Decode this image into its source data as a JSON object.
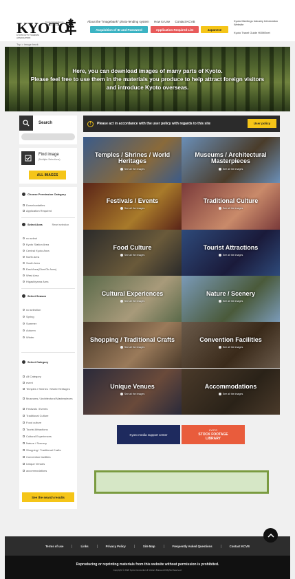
{
  "header": {
    "logo": "KYOTO",
    "logo_subtitle": "KYOTO CITY TOURISM ASSOCIATION",
    "logo_caption": "Kyoto Convention & Visitors Bureau",
    "nav_links": [
      "About the \"imagebank\" photo-lending system",
      "How to Use",
      "Contact KCVB"
    ],
    "right_links": [
      "Kyoto Meetings Industry Information Website",
      "Kyoto Travel Guide HOMEnet"
    ],
    "buttons": {
      "acquisition": "Acquisition of ID and Password",
      "application": "Application Required List",
      "language": "Japanese"
    }
  },
  "breadcrumb": "Top > image bank",
  "hero": {
    "line1": "Here, you can download images of many parts of Kyoto.",
    "line2": "Please feel free to use them in the materials you produce to help attract foreign visitors",
    "line3": "and introduce Kyoto overseas."
  },
  "search": {
    "label": "Search",
    "placeholder": ""
  },
  "find": {
    "label": "Find image",
    "sub": "(Multiple Selections)",
    "all_images": "ALL IMAGES"
  },
  "filters": {
    "permission": {
      "title": "Choose Permission Category",
      "items": [
        "Downloadables",
        "Application Required"
      ]
    },
    "area": {
      "title": "Select Area",
      "reset": "Reset selection",
      "items": [
        "no select",
        "Kyoto Station Area",
        "Central Kyoto Area",
        "North Area",
        "South Area",
        "East Area(Gion/Ok Area)",
        "West Area",
        "Higashiyama Area"
      ]
    },
    "season": {
      "title": "Select Season",
      "items": [
        "no selection",
        "Spring",
        "Summer",
        "Autumn",
        "Winter"
      ]
    },
    "category": {
      "title": "Select Category",
      "items": [
        "All Category",
        "event",
        "Temples / Shrines / World Heritages",
        "Museums / Architectural Masterpieces",
        "Festivals / Events",
        "Traditional Culture",
        "Food culture",
        "Tourist Attractions",
        "Cultural Experiences",
        "Nature / Scenery",
        "Shopping / Traditional Crafts",
        "Convention facilities",
        "Unique Venues",
        "accommodations"
      ]
    },
    "see_results": "See the search results"
  },
  "notice": {
    "text": "Please act in accordance with the user policy with regards to this site",
    "button": "User policy"
  },
  "tiles": [
    {
      "title": "Temples / Shrines / World Heritages",
      "see": "See all the images",
      "bg1": "#3a5b8a",
      "bg2": "#8a6a3a"
    },
    {
      "title": "Museums / Architectural Masterpieces",
      "see": "See all the images",
      "bg1": "#6a8fb8",
      "bg2": "#4a3c2a"
    },
    {
      "title": "Festivals / Events",
      "see": "See all the images",
      "bg1": "#5a2418",
      "bg2": "#a87a2a"
    },
    {
      "title": "Traditional Culture",
      "see": "See all the images",
      "bg1": "#7a3a3a",
      "bg2": "#c98a6a"
    },
    {
      "title": "Food Culture",
      "see": "See all the images",
      "bg1": "#2a2a2a",
      "bg2": "#6a5a3a"
    },
    {
      "title": "Tourist Attractions",
      "see": "See all the images",
      "bg1": "#2e4a7a",
      "bg2": "#1a1a3a"
    },
    {
      "title": "Cultural Experiences",
      "see": "See all the images",
      "bg1": "#5a6a4a",
      "bg2": "#a89a7a"
    },
    {
      "title": "Nature / Scenery",
      "see": "See all the images",
      "bg1": "#7a9ab8",
      "bg2": "#4a5a3a"
    },
    {
      "title": "Shopping / Traditional Crafts",
      "see": "See all the images",
      "bg1": "#4a3a2a",
      "bg2": "#9a7a5a"
    },
    {
      "title": "Convention Facilities",
      "see": "See all the images",
      "bg1": "#6a5a4a",
      "bg2": "#3a2a1a"
    },
    {
      "title": "Unique Venues",
      "see": "See all the images",
      "bg1": "#2a2a3a",
      "bg2": "#6a4a3a"
    },
    {
      "title": "Accommodations",
      "see": "See all the images",
      "bg1": "#4a3a2a",
      "bg2": "#2a2218"
    }
  ],
  "banners": {
    "media": "Kyoto media support center",
    "stock_top": "KYOTO",
    "stock": "STOCK FOOTAGE",
    "stock_bottom": "LIBRARY"
  },
  "footer": {
    "links": [
      "Terms of use",
      "Links",
      "Privacy Policy",
      "Site Map",
      "Frequently Asked Questions",
      "Contact KCVB"
    ],
    "warning": "Reproducing or reprinting materials from this website without permission is prohibited.",
    "copyright": "Copyright © 2020 Kyoto Convention & Visitors Bureau All Rights Reserved."
  },
  "colors": {
    "accent": "#f5c518",
    "teal": "#3bb3c3",
    "red": "#e85a5a",
    "navy": "#1e2a5e",
    "orange": "#e95c3c"
  }
}
